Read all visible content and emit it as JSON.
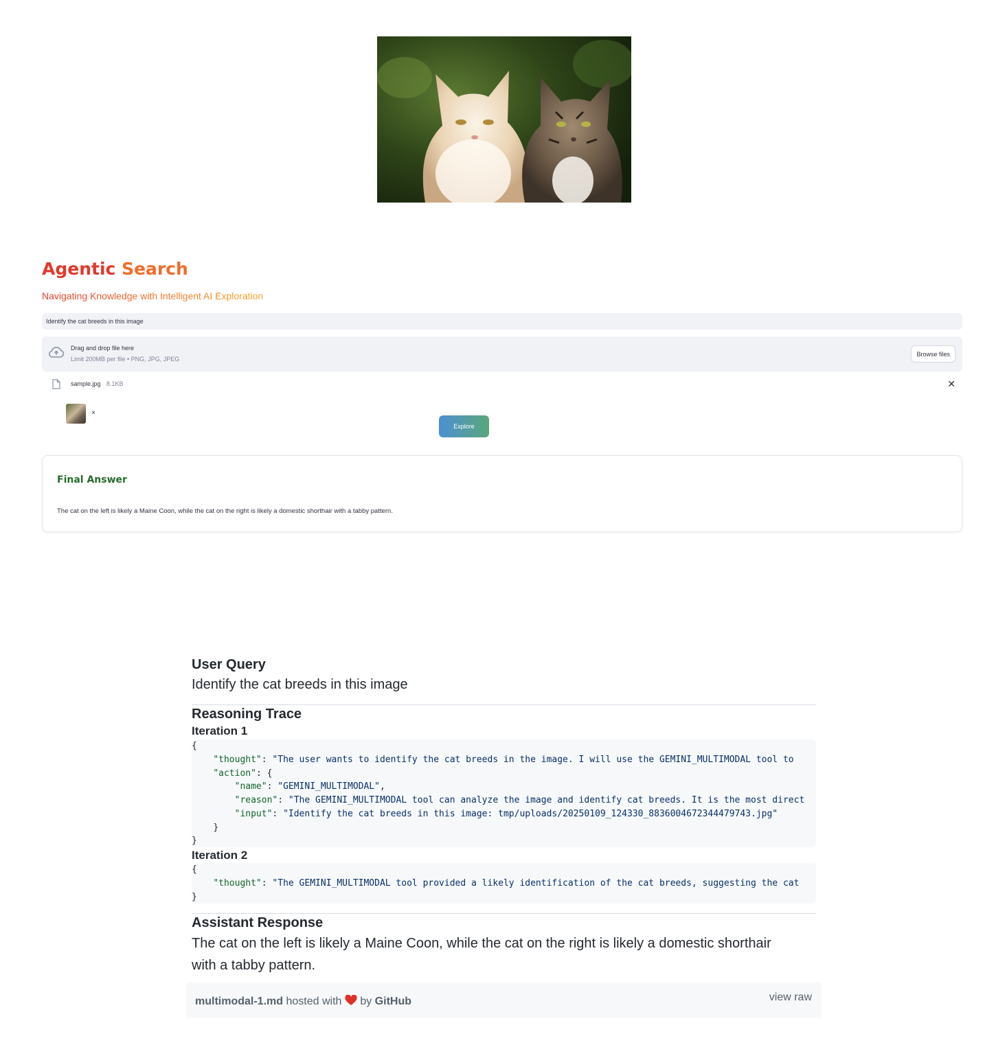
{
  "app": {
    "title_part1": "Agentic",
    "title_part2": "Search",
    "subtitle": "Navigating Knowledge with Intelligent AI Exploration",
    "query_value": "Identify the cat breeds in this image",
    "uploader": {
      "title": "Drag and drop file here",
      "limit": "Limit 200MB per file • PNG, JPG, JPEG",
      "browse_label": "Browse files"
    },
    "file": {
      "name": "sample.jpg",
      "size": "8.1KB",
      "close": "✕"
    },
    "thumb_close": "×",
    "explore_label": "Explore",
    "final_answer": {
      "title": "Final Answer",
      "text": "The cat on the left is likely a Maine Coon, while the cat on the right is likely a domestic shorthair with a tabby pattern."
    }
  },
  "gist": {
    "user_query_heading": "User Query",
    "user_query_text": "Identify the cat breeds in this image",
    "reasoning_heading": "Reasoning Trace",
    "iteration1_heading": "Iteration 1",
    "iteration1": {
      "thought_key": "\"thought\"",
      "thought_val": "\"The user wants to identify the cat breeds in the image. I will use the GEMINI_MULTIMODAL tool to",
      "action_key": "\"action\"",
      "name_key": "\"name\"",
      "name_val": "\"GEMINI_MULTIMODAL\"",
      "reason_key": "\"reason\"",
      "reason_val": "\"The GEMINI_MULTIMODAL tool can analyze the image and identify cat breeds. It is the most direct",
      "input_key": "\"input\"",
      "input_val": "\"Identify the cat breeds in this image: tmp/uploads/20250109_124330_8836004672344479743.jpg\""
    },
    "iteration2_heading": "Iteration 2",
    "iteration2": {
      "thought_key": "\"thought\"",
      "thought_val": "\"The GEMINI_MULTIMODAL tool provided a likely identification of the cat breeds, suggesting the cat"
    },
    "assistant_heading": "Assistant Response",
    "assistant_text": "The cat on the left is likely a Maine Coon, while the cat on the right is likely a domestic shorthair with a tabby pattern.",
    "footer": {
      "filename": "multimodal-1.md",
      "hosted": "hosted with",
      "by": "by",
      "github": "GitHub",
      "view_raw": "view raw"
    }
  }
}
